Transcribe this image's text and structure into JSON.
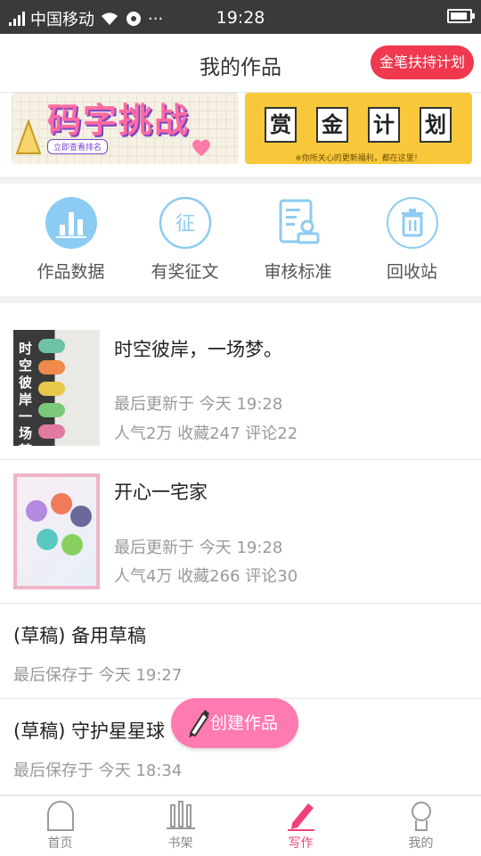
{
  "status_bar": {
    "carrier": "中国移动",
    "time": "19:28",
    "more": "···"
  },
  "header": {
    "title": "我的作品",
    "plan_button": "金笔扶持计划"
  },
  "banners": {
    "left": {
      "title": "码字挑战",
      "subtitle": "立即查看排名"
    },
    "right": {
      "chars": [
        "赏",
        "金",
        "计",
        "划"
      ],
      "subtitle": "※你所关心的更新福利，都在这里！"
    }
  },
  "quick_menu": [
    {
      "label": "作品数据",
      "icon": "bar-chart-icon"
    },
    {
      "label": "有奖征文",
      "icon": "zheng-icon"
    },
    {
      "label": "审核标准",
      "icon": "document-stamp-icon"
    },
    {
      "label": "回收站",
      "icon": "trash-icon"
    }
  ],
  "works": [
    {
      "title": "时空彼岸，一场梦。",
      "updated": "最后更新于 今天 19:28",
      "stats": "人气2万 收藏247 评论22",
      "cover_text": "时空彼岸一场梦"
    },
    {
      "title": "开心一宅家",
      "updated": "最后更新于 今天 19:28",
      "stats": "人气4万 收藏266 评论30"
    }
  ],
  "drafts": [
    {
      "title": "(草稿) 备用草稿",
      "saved": "最后保存于 今天 19:27"
    },
    {
      "title": "(草稿) 守护星星球",
      "saved": "最后保存于 今天 18:34"
    }
  ],
  "create_button": "创建作品",
  "tabbar": [
    {
      "label": "首页",
      "icon": "home-icon"
    },
    {
      "label": "书架",
      "icon": "bookshelf-icon"
    },
    {
      "label": "写作",
      "icon": "pen-icon",
      "active": true
    },
    {
      "label": "我的",
      "icon": "profile-icon"
    }
  ],
  "colors": {
    "accent": "#f0407c",
    "plan_button": "#f0384e",
    "icon_blue": "#6cb8ec",
    "create_button": "#ff7ab0"
  }
}
